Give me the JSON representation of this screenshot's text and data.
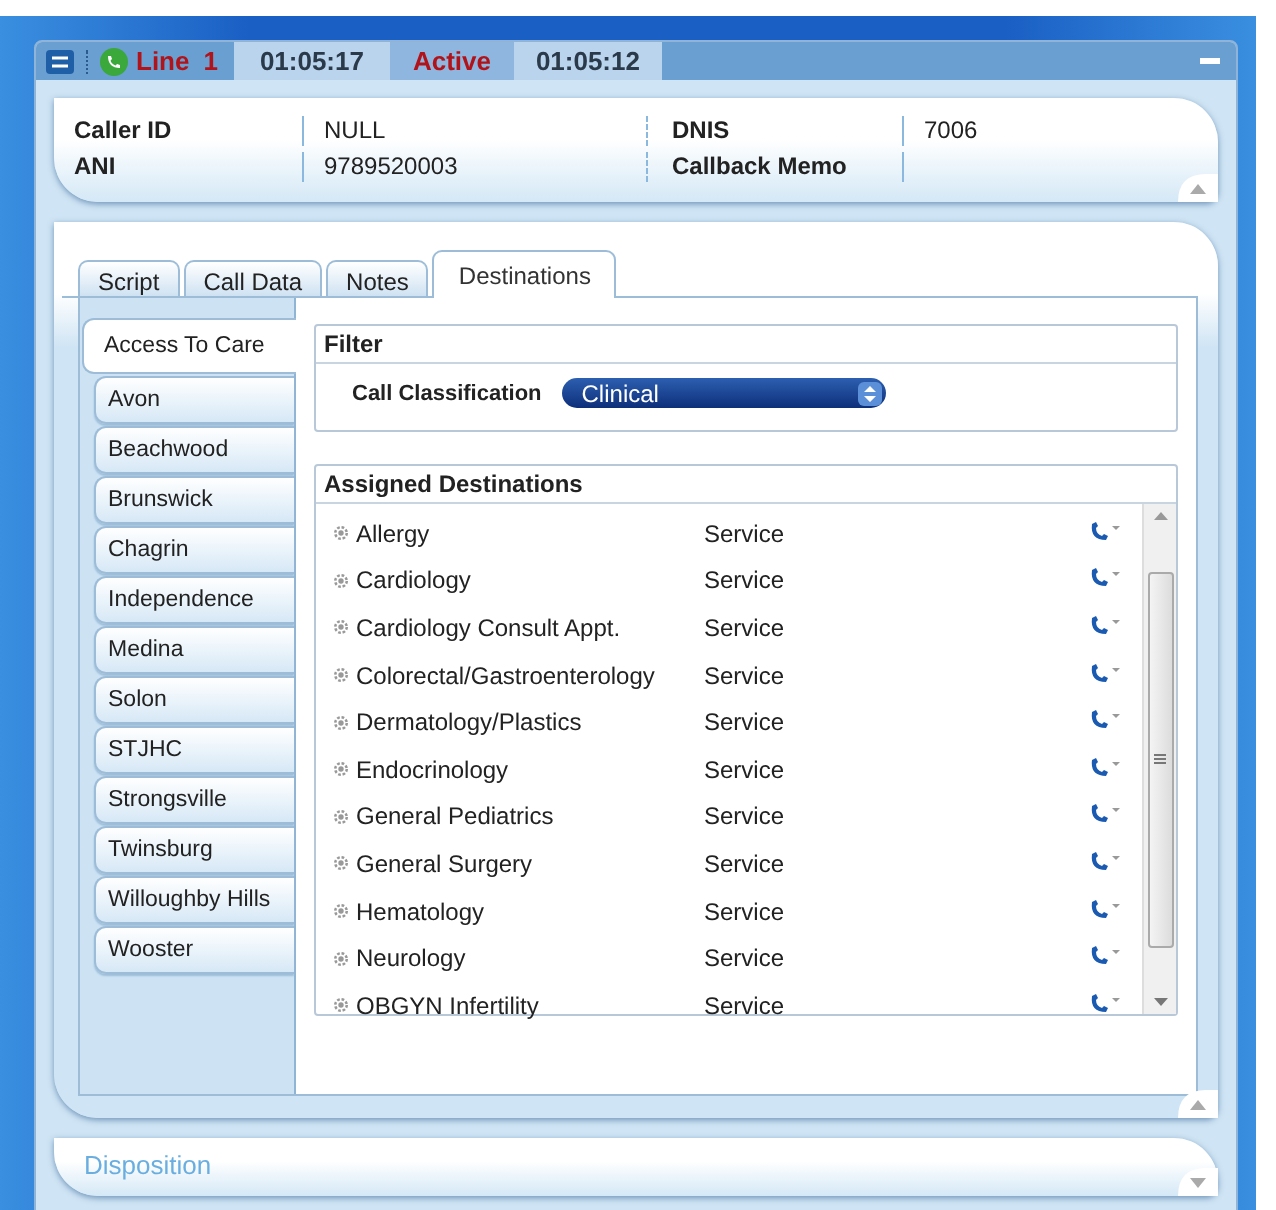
{
  "title_bar": {
    "line_label": "Line",
    "line_number": "1",
    "line_timer": "01:05:17",
    "status": "Active",
    "status_timer": "01:05:12"
  },
  "caller_info": {
    "columns": [
      {
        "label": "Caller ID",
        "value": "NULL"
      },
      {
        "label": "ANI",
        "value": "9789520003"
      },
      {
        "label": "DNIS",
        "value": "7006"
      },
      {
        "label": "Callback Memo"
      }
    ]
  },
  "tabs": [
    {
      "label": "Script",
      "selected": false
    },
    {
      "label": "Call Data",
      "selected": false
    },
    {
      "label": "Notes",
      "selected": false
    },
    {
      "label": "Destinations",
      "selected": true
    }
  ],
  "locations": [
    {
      "label": "Access To Care",
      "selected": true
    },
    {
      "label": "Avon",
      "selected": false
    },
    {
      "label": "Beachwood",
      "selected": false
    },
    {
      "label": "Brunswick",
      "selected": false
    },
    {
      "label": "Chagrin",
      "selected": false
    },
    {
      "label": "Independence",
      "selected": false
    },
    {
      "label": "Medina",
      "selected": false
    },
    {
      "label": "Solon",
      "selected": false
    },
    {
      "label": "STJHC",
      "selected": false
    },
    {
      "label": "Strongsville",
      "selected": false
    },
    {
      "label": "Twinsburg",
      "selected": false
    },
    {
      "label": "Willoughby Hills",
      "selected": false
    },
    {
      "label": "Wooster",
      "selected": false
    }
  ],
  "filter": {
    "title": "Filter",
    "label": "Call Classification",
    "value": "Clinical"
  },
  "destinations": {
    "title": "Assigned Destinations",
    "rows": [
      {
        "name": "Allergy",
        "type": "Service"
      },
      {
        "name": "Cardiology",
        "type": "Service"
      },
      {
        "name": "Cardiology Consult Appt.",
        "type": "Service"
      },
      {
        "name": "Colorectal/Gastroenterology",
        "type": "Service"
      },
      {
        "name": "Dermatology/Plastics",
        "type": "Service"
      },
      {
        "name": "Endocrinology",
        "type": "Service"
      },
      {
        "name": "General Pediatrics",
        "type": "Service"
      },
      {
        "name": "General Surgery",
        "type": "Service"
      },
      {
        "name": "Hematology",
        "type": "Service"
      },
      {
        "name": "Neurology",
        "type": "Service"
      },
      {
        "name": "OBGYN Infertility",
        "type": "Service"
      }
    ]
  },
  "disposition": {
    "title": "Disposition"
  }
}
